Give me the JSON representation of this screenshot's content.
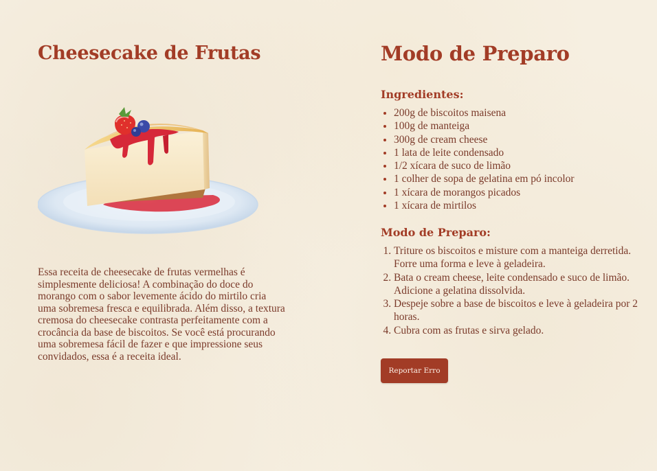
{
  "left": {
    "title": "Cheesecake de Frutas",
    "image": "cheesecake-illustration",
    "description": "Essa receita de cheesecake de frutas vermelhas é simplesmente deliciosa! A combinação do doce do morango com o sabor levemente ácido do mirtilo cria uma sobremesa fresca e equilibrada. Além disso, a textura cremosa do cheesecake contrasta perfeitamente com a crocância da base de biscoitos. Se você está procurando uma sobremesa fácil de fazer e que impressione seus convidados, essa é a receita ideal."
  },
  "right": {
    "title": "Modo de Preparo",
    "ingredients_title": "Ingredientes:",
    "ingredients": [
      "200g de biscoitos maisena",
      "100g de manteiga",
      "300g de cream cheese",
      "1 lata de leite condensado",
      "1/2 xícara de suco de limão",
      "1 colher de sopa de gelatina em pó incolor",
      "1 xícara de morangos picados",
      "1 xícara de mirtilos"
    ],
    "steps_title": "Modo de Preparo:",
    "steps": [
      "Triture os biscoitos e misture com a manteiga derretida. Forre uma forma e leve à geladeira.",
      "Bata o cream cheese, leite condensado e suco de limão. Adicione a gelatina dissolvida.",
      "Despeje sobre a base de biscoitos e leve à geladeira por 2 horas.",
      "Cubra com as frutas e sirva gelado."
    ],
    "report_button": "Reportar Erro"
  },
  "colors": {
    "background": "#f6efe1",
    "heading": "#a23c26",
    "text": "#7a3a2a",
    "button": "#a23c26"
  }
}
